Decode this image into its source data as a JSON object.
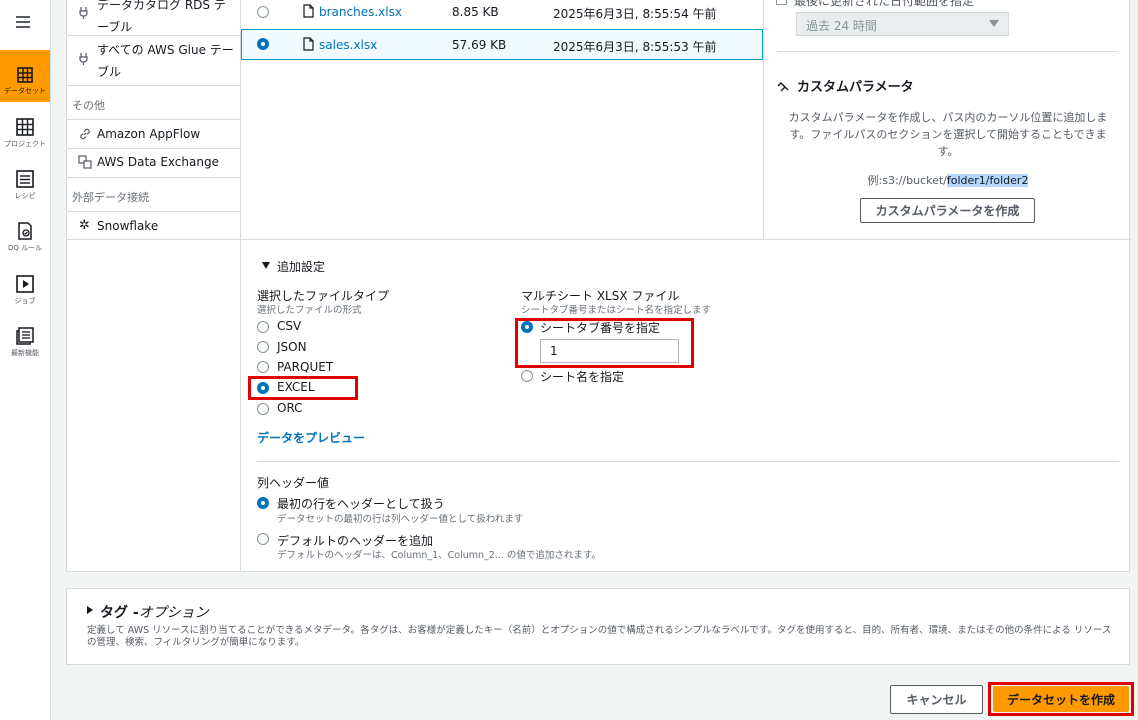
{
  "rail": {
    "items": [
      {
        "label": "データセット"
      },
      {
        "label": "プロジェクト"
      },
      {
        "label": "レシピ"
      },
      {
        "label": "DQ ルール"
      },
      {
        "label": "ジョブ"
      },
      {
        "label": "最新機能"
      }
    ]
  },
  "sources": {
    "rds_label": "データカタログ RDS テーブル",
    "glue_label": "すべての AWS Glue テーブル",
    "other_head": "その他",
    "appflow": "Amazon AppFlow",
    "dataexchange": "AWS Data Exchange",
    "external_head": "外部データ接続",
    "snowflake": "Snowflake"
  },
  "files": [
    {
      "name": "branches.xlsx",
      "size": "8.85 KB",
      "modified": "2025年6月3日, 8:55:54 午前",
      "selected": false
    },
    {
      "name": "sales.xlsx",
      "size": "57.69 KB",
      "modified": "2025年6月3日, 8:55:53 午前",
      "selected": true
    }
  ],
  "range": {
    "checkbox_label": "最後に更新された日付範囲を指定",
    "select_value": "過去 24 時間"
  },
  "custom_param": {
    "title": "カスタムパラメータ",
    "description": "カスタムパラメータを作成し、パス内のカーソル位置に追加します。ファイルパスのセクションを選択して開始することもできます。",
    "example_prefix": "例:s3://bucket/",
    "example_highlight": "folder1/folder2",
    "button": "カスタムパラメータを作成"
  },
  "advanced": {
    "toggle_label": "追加設定",
    "filetype_label": "選択したファイルタイプ",
    "filetype_sub": "選択したファイルの形式",
    "filetypes": [
      "CSV",
      "JSON",
      "PARQUET",
      "EXCEL",
      "ORC"
    ],
    "selected_filetype": "EXCEL",
    "preview_link": "データをプレビュー",
    "multisheet_label": "マルチシート XLSX ファイル",
    "multisheet_sub": "シートタブ番号またはシート名を指定します",
    "sheet_number_option": "シートタブ番号を指定",
    "sheet_number_value": "1",
    "sheet_name_option": "シート名を指定"
  },
  "header": {
    "label": "列ヘッダー値",
    "option1": "最初の行をヘッダーとして扱う",
    "option1_sub": "データセットの最初の行は列ヘッダー値として扱われます",
    "option2": "デフォルトのヘッダーを追加",
    "option2_sub": "デフォルトのヘッダーは、Column_1、Column_2... の値で追加されます。"
  },
  "tags": {
    "title_bold": "タグ -",
    "title_rest": "オプション",
    "description": "定義して AWS リソースに割り当てることができるメタデータ。各タグは、お客様が定義したキー（名前）とオプションの値で構成されるシンプルなラベルです。タグを使用すると、目的、所有者、環境、またはその他の条件による リソースの管理、検索、フィルタリングが簡単になります。"
  },
  "footer": {
    "cancel": "キャンセル",
    "create": "データセットを作成"
  }
}
